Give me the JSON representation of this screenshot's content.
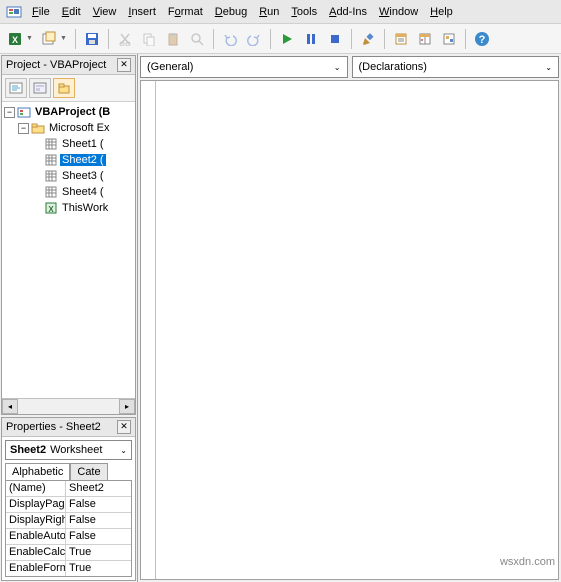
{
  "menubar": {
    "items": [
      "File",
      "Edit",
      "View",
      "Insert",
      "Format",
      "Debug",
      "Run",
      "Tools",
      "Add-Ins",
      "Window",
      "Help"
    ]
  },
  "toolbar": {
    "excel_icon": "excel-icon",
    "buttons": [
      "view-host",
      "insert-module",
      "save",
      "cut",
      "copy",
      "paste",
      "find",
      "undo",
      "redo",
      "run",
      "pause",
      "stop",
      "design-mode",
      "project-explorer",
      "properties-window",
      "object-browser",
      "toolbox",
      "help"
    ]
  },
  "project_panel": {
    "title": "Project - VBAProject",
    "tree": {
      "root": "VBAProject (B",
      "folder": "Microsoft Ex",
      "sheets": [
        "Sheet1 (",
        "Sheet2 (",
        "Sheet3 (",
        "Sheet4 ("
      ],
      "workbook": "ThisWork",
      "selected_index": 1
    }
  },
  "properties_panel": {
    "title": "Properties - Sheet2",
    "object_name": "Sheet2",
    "object_type": "Worksheet",
    "tabs": [
      "Alphabetic",
      "Cate"
    ],
    "active_tab": 0,
    "rows": [
      {
        "name": "(Name)",
        "value": "Sheet2"
      },
      {
        "name": "DisplayPage",
        "value": "False"
      },
      {
        "name": "DisplayRight",
        "value": "False"
      },
      {
        "name": "EnableAutoF",
        "value": "False"
      },
      {
        "name": "EnableCalcu",
        "value": "True"
      },
      {
        "name": "EnableForma",
        "value": "True"
      }
    ]
  },
  "code_pane": {
    "object_dropdown": "(General)",
    "proc_dropdown": "(Declarations)"
  },
  "watermark": "wsxdn.com"
}
